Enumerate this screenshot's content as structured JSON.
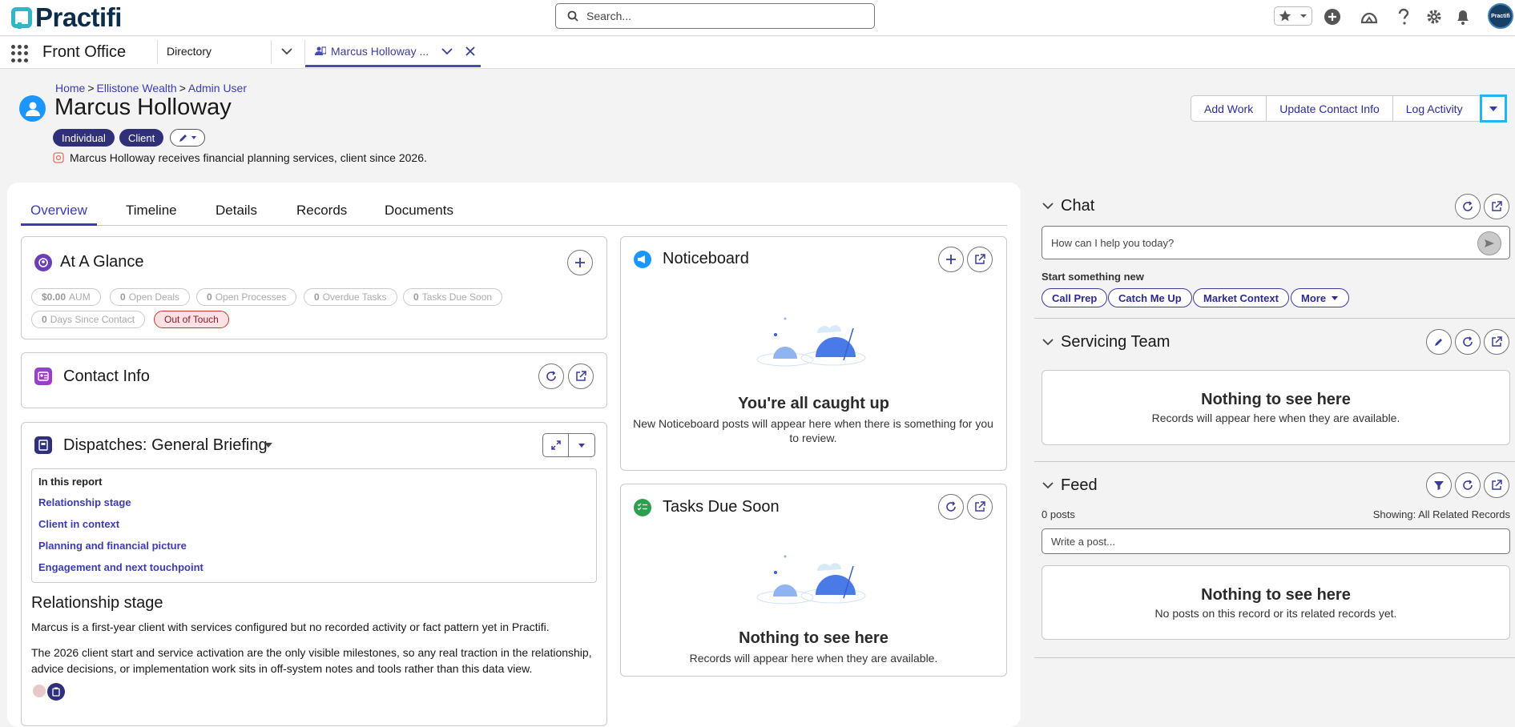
{
  "app": {
    "logo_text": "Practifi",
    "app_name": "Front Office"
  },
  "topbar": {
    "search_placeholder": "Search...",
    "avatar_text": "Practifi"
  },
  "navbar": {
    "directory_label": "Directory",
    "open_tab_label": "Marcus Holloway ..."
  },
  "header": {
    "breadcrumbs": [
      "Home",
      "Ellistone Wealth",
      "Admin User"
    ],
    "breadcrumb_sep": ">",
    "name": "Marcus Holloway",
    "tags": [
      "Individual",
      "Client"
    ],
    "description": "Marcus Holloway receives financial planning services, client since 2026.",
    "actions": [
      "Add Work",
      "Update Contact Info",
      "Log Activity"
    ]
  },
  "tabs": [
    "Overview",
    "Timeline",
    "Details",
    "Records",
    "Documents"
  ],
  "at_a_glance": {
    "title": "At A Glance",
    "metrics": [
      {
        "value": "$0.00",
        "label": "AUM"
      },
      {
        "value": "0",
        "label": "Open Deals"
      },
      {
        "value": "0",
        "label": "Open Processes"
      },
      {
        "value": "0",
        "label": "Overdue Tasks"
      },
      {
        "value": "0",
        "label": "Tasks Due Soon"
      },
      {
        "value": "0",
        "label": "Days Since Contact"
      }
    ],
    "status_badge": "Out of Touch"
  },
  "contact_info": {
    "title": "Contact Info"
  },
  "dispatches": {
    "title_prefix": "Dispatches:",
    "title_value": "General Briefing",
    "toc_heading": "In this report",
    "toc_links": [
      "Relationship stage",
      "Client in context",
      "Planning and financial picture",
      "Engagement and next touchpoint"
    ],
    "section_heading": "Relationship stage",
    "paragraphs": [
      "Marcus is a first-year client with services configured but no recorded activity or fact pattern yet in Practifi.",
      "The 2026 client start and service activation are the only visible milestones, so any real traction in the relationship, advice decisions, or implementation work sits in off-system notes and tools rather than this data view."
    ]
  },
  "noticeboard": {
    "title": "Noticeboard",
    "empty_title": "You're all caught up",
    "empty_sub": "New Noticeboard posts will appear here when there is something for you to review."
  },
  "tasks_due_soon": {
    "title": "Tasks Due Soon",
    "empty_title": "Nothing to see here",
    "empty_sub": "Records will appear here when they are available."
  },
  "chat": {
    "title": "Chat",
    "input_placeholder": "How can I help you today?",
    "start_label": "Start something new",
    "chips": [
      "Call Prep",
      "Catch Me Up",
      "Market Context",
      "More"
    ]
  },
  "servicing_team": {
    "title": "Servicing Team",
    "empty_title": "Nothing to see here",
    "empty_sub": "Records will appear here when they are available."
  },
  "feed": {
    "title": "Feed",
    "post_count": "0 posts",
    "showing": "Showing: All Related Records",
    "input_placeholder": "Write a post...",
    "empty_title": "Nothing to see here",
    "empty_sub": "No posts on this record or its related records yet."
  },
  "colors": {
    "brand": "#31b6c8",
    "accent": "#3b3bb0",
    "pill": "#30307a",
    "focus": "#1fb6f5"
  }
}
